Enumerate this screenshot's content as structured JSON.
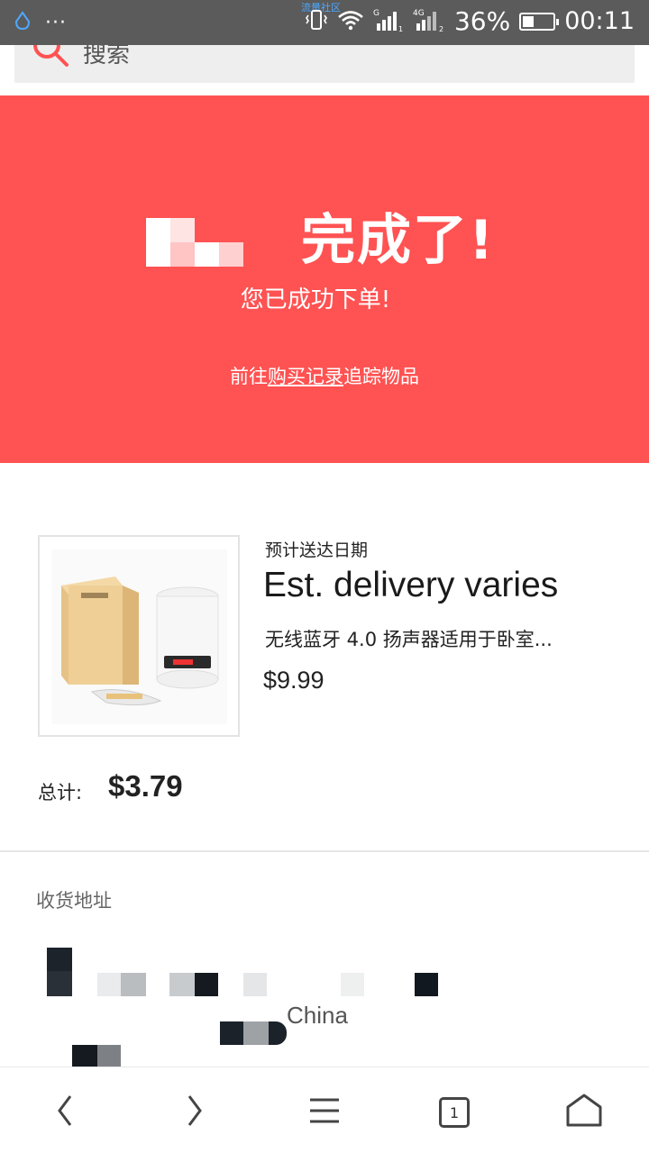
{
  "status_bar": {
    "carrier": "流量社区",
    "battery_percent": 36,
    "battery_text": "36%",
    "time": "00:11",
    "signal_icons": [
      "vibrate-icon",
      "wifi-icon",
      "signal-g-icon",
      "signal-4g-icon"
    ]
  },
  "search": {
    "placeholder": "搜索"
  },
  "banner": {
    "title": "完成了!",
    "subtitle": "您已成功下单!",
    "link_prefix": "前往",
    "link_text": "购买记录",
    "link_suffix": "追踪物品",
    "bg_color": "#ff5252"
  },
  "order": {
    "est_label": "预计送达日期",
    "est_value": "Est. delivery varies",
    "product_title": "无线蓝牙 4.0 扬声器适用于卧室...",
    "product_price": "$9.99",
    "total_label": "总计:",
    "total_value": "$3.79"
  },
  "address": {
    "label": "收货地址",
    "visible_text": "China"
  },
  "bottom_nav": {
    "tab_count": "1"
  }
}
